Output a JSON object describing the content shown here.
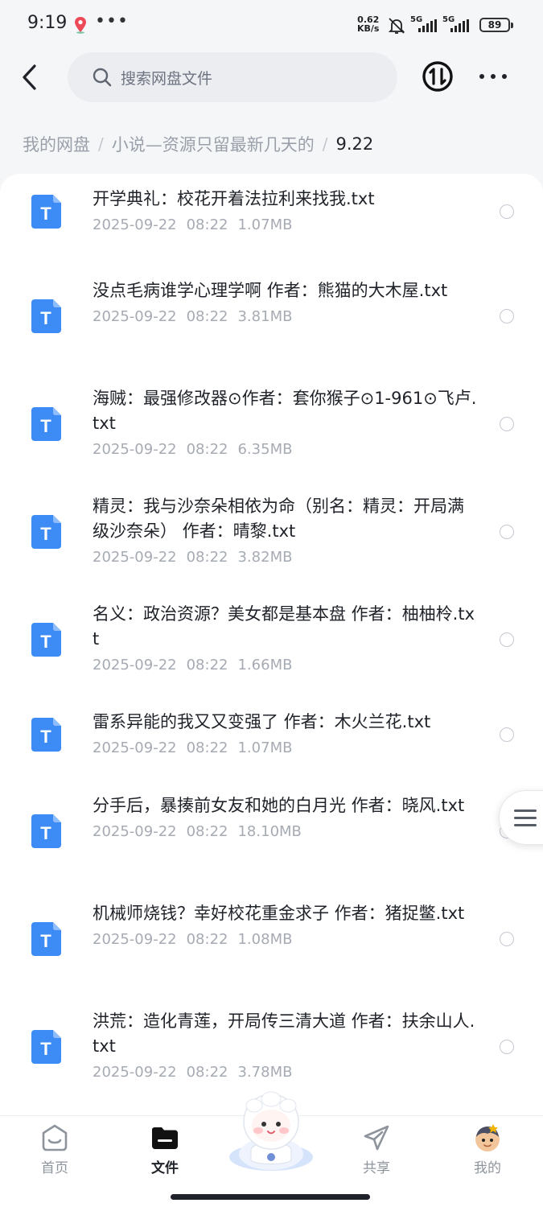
{
  "status_bar": {
    "time": "9:19",
    "net_speed_value": "0.62",
    "net_speed_unit": "KB/s",
    "signal1_label": "5G",
    "signal2_label": "5G",
    "battery": "89"
  },
  "search": {
    "placeholder": "搜索网盘文件"
  },
  "breadcrumb": {
    "items": [
      "我的网盘",
      "小说—资源只留最新几天的",
      "9.22"
    ],
    "separator": "/"
  },
  "files": [
    {
      "name": "开学典礼：校花开着法拉利来找我.txt",
      "date": "2025-09-22",
      "time": "08:22",
      "size": "1.07MB"
    },
    {
      "name": "没点毛病谁学心理学啊 作者：熊猫的大木屋.txt",
      "date": "2025-09-22",
      "time": "08:22",
      "size": "3.81MB"
    },
    {
      "name": "海贼：最强修改器⊙作者：套你猴子⊙1-961⊙飞卢.txt",
      "date": "2025-09-22",
      "time": "08:22",
      "size": "6.35MB"
    },
    {
      "name": "精灵：我与沙奈朵相依为命（别名：精灵：开局满级沙奈朵） 作者：晴黎.txt",
      "date": "2025-09-22",
      "time": "08:22",
      "size": "3.82MB"
    },
    {
      "name": "名义：政治资源？美女都是基本盘 作者：柚柚柃.txt",
      "date": "2025-09-22",
      "time": "08:22",
      "size": "1.66MB"
    },
    {
      "name": "雷系异能的我又又变强了 作者：木火兰花.txt",
      "date": "2025-09-22",
      "time": "08:22",
      "size": "1.07MB"
    },
    {
      "name": "分手后，暴揍前女友和她的白月光 作者：晓风.txt",
      "date": "2025-09-22",
      "time": "08:22",
      "size": "18.10MB"
    },
    {
      "name": "机械师烧钱？幸好校花重金求子 作者：猪捉鳖.txt",
      "date": "2025-09-22",
      "time": "08:22",
      "size": "1.08MB"
    },
    {
      "name": "洪荒：造化青莲，开局传三清大道 作者：扶余山人.txt",
      "date": "2025-09-22",
      "time": "08:22",
      "size": "3.78MB"
    }
  ],
  "file_icon_letter": "T",
  "bottom_nav": {
    "home": "首页",
    "files": "文件",
    "share": "共享",
    "mine": "我的"
  },
  "colors": {
    "file_icon": "#3d8cf5",
    "text_primary": "#1f2329",
    "text_secondary": "#a6abb3"
  }
}
